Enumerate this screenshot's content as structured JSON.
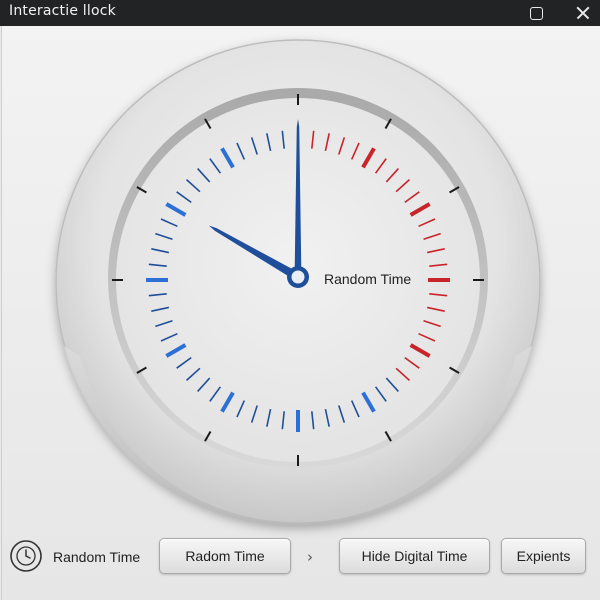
{
  "window": {
    "title": "Interactie llock"
  },
  "icons": {
    "maximize": "maximize-icon",
    "close": "close-icon",
    "clock_mode": "clock-outline-icon",
    "chevron": "chevron-right-icon"
  },
  "clock": {
    "label": "Random Time",
    "time": {
      "hour": 10,
      "minute": 0
    },
    "colors": {
      "hands": "#1f4f9a",
      "blue_ticks": "#1f4f9a",
      "accent_blue": "#2c6fd6",
      "red_ticks": "#c8242a",
      "outer_ticks": "#1a1a1a"
    }
  },
  "controls": {
    "mode_label": "Random Time",
    "random_button": "Radom Time",
    "chevron": "›",
    "hide_digital_button": "Hide Digital Time",
    "experiments_button": "Expients"
  }
}
